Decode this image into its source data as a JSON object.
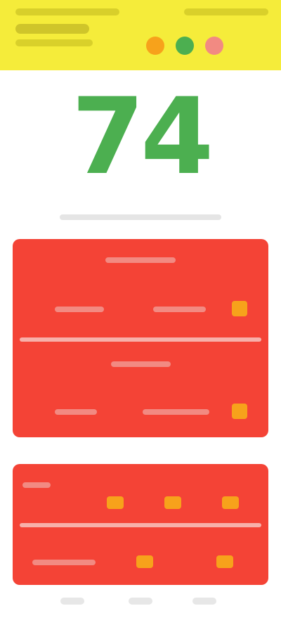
{
  "header": {
    "background_color": "#f5ec3a",
    "status_dots": [
      {
        "icon": "status-dot-icon",
        "color": "#f7a21b"
      },
      {
        "icon": "status-dot-icon",
        "color": "#4caf50"
      },
      {
        "icon": "status-dot-icon",
        "color": "#f28a82"
      }
    ]
  },
  "score": {
    "value": "74",
    "color": "#4caf50"
  },
  "panels": {
    "color": "#f44336",
    "indicator_color": "#f7a21b"
  }
}
